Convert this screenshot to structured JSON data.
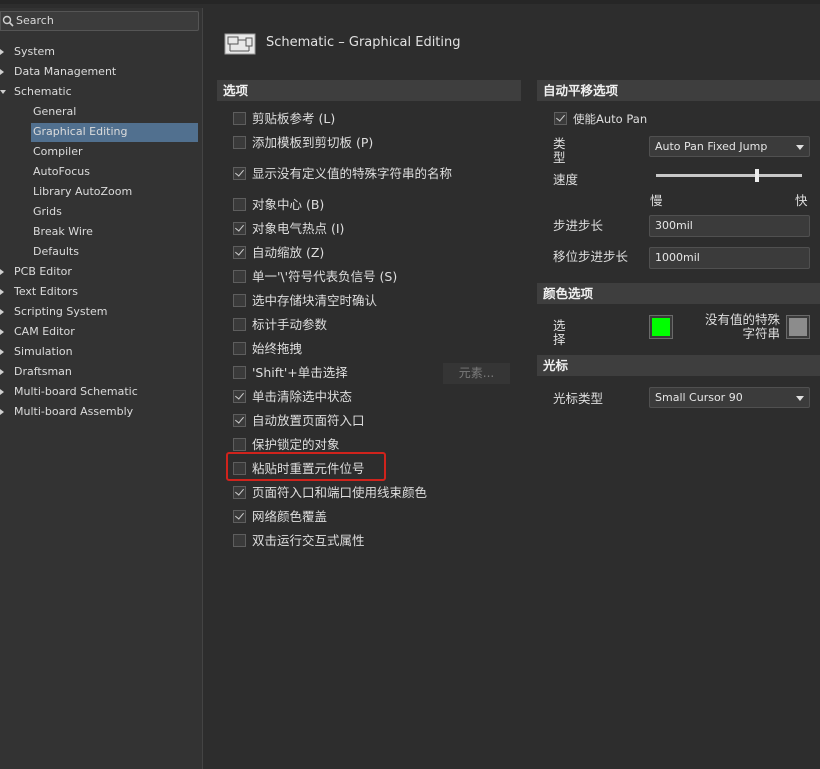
{
  "search": {
    "placeholder": "Search"
  },
  "tree": [
    {
      "label": "System",
      "level": 0,
      "expanded": false
    },
    {
      "label": "Data Management",
      "level": 0,
      "expanded": false
    },
    {
      "label": "Schematic",
      "level": 0,
      "expanded": true
    },
    {
      "label": "General",
      "level": 1
    },
    {
      "label": "Graphical Editing",
      "level": 1,
      "selected": true
    },
    {
      "label": "Compiler",
      "level": 1
    },
    {
      "label": "AutoFocus",
      "level": 1
    },
    {
      "label": "Library AutoZoom",
      "level": 1
    },
    {
      "label": "Grids",
      "level": 1
    },
    {
      "label": "Break Wire",
      "level": 1
    },
    {
      "label": "Defaults",
      "level": 1
    },
    {
      "label": "PCB Editor",
      "level": 0,
      "expanded": false
    },
    {
      "label": "Text Editors",
      "level": 0,
      "expanded": false
    },
    {
      "label": "Scripting System",
      "level": 0,
      "expanded": false
    },
    {
      "label": "CAM Editor",
      "level": 0,
      "expanded": false
    },
    {
      "label": "Simulation",
      "level": 0,
      "expanded": false
    },
    {
      "label": "Draftsman",
      "level": 0,
      "expanded": false
    },
    {
      "label": "Multi-board Schematic",
      "level": 0,
      "expanded": false
    },
    {
      "label": "Multi-board Assembly",
      "level": 0,
      "expanded": false
    }
  ],
  "page": {
    "title": "Schematic – Graphical Editing"
  },
  "options": {
    "header": "选项",
    "items": [
      {
        "label": "剪贴板参考 (L)",
        "checked": false
      },
      {
        "label": "添加模板到剪切板 (P)",
        "checked": false
      },
      {
        "label": "显示没有定义值的特殊字符串的名称",
        "checked": true
      },
      {
        "label": "对象中心 (B)",
        "checked": false
      },
      {
        "label": "对象电气热点 (I)",
        "checked": true
      },
      {
        "label": "自动缩放 (Z)",
        "checked": true
      },
      {
        "label": "单一'\\'符号代表负信号 (S)",
        "checked": false
      },
      {
        "label": "选中存储块清空时确认",
        "checked": false
      },
      {
        "label": "标计手动参数",
        "checked": false
      },
      {
        "label": "始终拖拽",
        "checked": false
      },
      {
        "label": "'Shift'+单击选择",
        "checked": false
      },
      {
        "label": "单击清除选中状态",
        "checked": true
      },
      {
        "label": "自动放置页面符入口",
        "checked": true
      },
      {
        "label": "保护锁定的对象",
        "checked": false
      },
      {
        "label": "粘贴时重置元件位号",
        "checked": false
      },
      {
        "label": "页面符入口和端口使用线束颜色",
        "checked": true
      },
      {
        "label": "网络颜色覆盖",
        "checked": true
      },
      {
        "label": "双击运行交互式属性",
        "checked": false
      }
    ],
    "elements_button": "元素..."
  },
  "autopan": {
    "header": "自动平移选项",
    "enable_label": "使能Auto Pan",
    "enable_checked": true,
    "type_label": "类型",
    "type_value": "Auto Pan Fixed Jump",
    "speed_label": "速度",
    "speed_level": 0.69,
    "slow_label": "慢",
    "fast_label": "快",
    "step_label": "步进步长",
    "step_value": "300mil",
    "shift_step_label": "移位步进步长",
    "shift_step_value": "1000mil"
  },
  "colors": {
    "header": "颜色选项",
    "selection_label": "选择",
    "selection_color": "#00ff00",
    "no_value_label": "没有值的特殊字符串",
    "no_value_color": "#8c8c8c"
  },
  "cursor": {
    "header": "光标",
    "type_label": "光标类型",
    "type_value": "Small Cursor 90"
  },
  "theme": {
    "accent": "#51708f",
    "highlight_border": "#d0231c"
  }
}
